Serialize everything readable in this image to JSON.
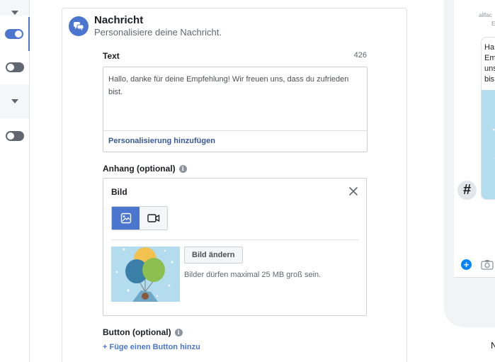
{
  "rail": {
    "toggles": [
      {
        "state": "on"
      },
      {
        "state": "off"
      },
      {
        "state": "off"
      }
    ]
  },
  "section": {
    "title": "Nachricht",
    "subtitle": "Personalisiere deine Nachricht."
  },
  "text_field": {
    "label": "Text",
    "counter": "426",
    "value": "Hallo, danke für deine Empfehlung! Wir freuen uns, dass du zufrieden bist.",
    "personalize_link": "Personalisierung hinzufügen"
  },
  "attachment": {
    "label": "Anhang (optional)",
    "box_title": "Bild",
    "change_button": "Bild ändern",
    "hint": "Bilder dürfen maximal 25 MB groß sein."
  },
  "button_section": {
    "label": "Button (optional)",
    "add_link": "+ Füge einen Button hinzu"
  },
  "preview": {
    "header_line1": "allfac",
    "header_line2": "E",
    "bubble_lines": [
      "Ha",
      "Em",
      "uns",
      "bis"
    ],
    "hashtag": "#",
    "bottom_text": "N"
  },
  "colors": {
    "accent": "#4a76d0",
    "link": "#385898",
    "border": "#ccd0d5"
  }
}
